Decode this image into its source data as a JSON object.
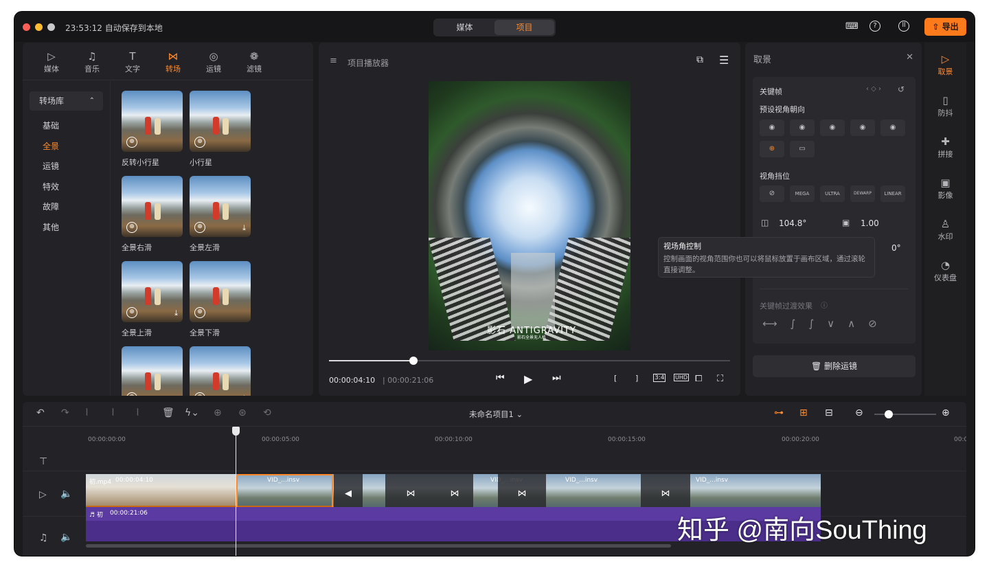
{
  "titlebar": {
    "autosave": "23:53:12 自动保存到本地",
    "tabs": [
      "媒体",
      "项目"
    ],
    "active_tab": "项目",
    "export_label": "导出",
    "traffic_colors": [
      "#ff5f57",
      "#febc2e",
      "#c9c9cc"
    ]
  },
  "left_tabs": [
    {
      "label": "媒体",
      "icon": "▷"
    },
    {
      "label": "音乐",
      "icon": "♫"
    },
    {
      "label": "文字",
      "icon": "T"
    },
    {
      "label": "转场",
      "icon": "⋈"
    },
    {
      "label": "运镜",
      "icon": "◎"
    },
    {
      "label": "滤镜",
      "icon": "❁"
    }
  ],
  "active_left_tab": "转场",
  "categories": {
    "header": "转场库",
    "items": [
      "基础",
      "全景",
      "运镜",
      "特效",
      "故障",
      "其他"
    ],
    "active": "全景"
  },
  "transitions": [
    {
      "label": "反转小行星",
      "download": false
    },
    {
      "label": "小行星",
      "download": false
    },
    {
      "label": "全景右滑",
      "download": false
    },
    {
      "label": "全景左滑",
      "download": true
    },
    {
      "label": "全景上滑",
      "download": true
    },
    {
      "label": "全景下滑",
      "download": false
    },
    {
      "label": "",
      "download": false
    },
    {
      "label": "",
      "download": true
    }
  ],
  "player": {
    "title": "项目播放器",
    "current_time": "00:00:04:10",
    "duration": "| 00:00:21:06",
    "progress": 0.21,
    "logo": "影石 ANTIGRAVITY",
    "logo_sub": "影石全景无人机",
    "ratio_label": "3:4",
    "uhd_label": "UHD"
  },
  "tooltip": {
    "title": "视场角控制",
    "body": "控制画面的视角范围你也可以将鼠标放置于画布区域，通过滚轮直接调整。"
  },
  "reframe": {
    "title": "取景",
    "keyframe": "关键帧",
    "preset_heading": "预设视角朝向",
    "view_preset_heading": "视角挡位",
    "lens_modes": [
      "MEGA",
      "ULTRA",
      "DEWARP",
      "LINEAR"
    ],
    "fov_value": "104.8°",
    "distance_value": "1.00",
    "partial_value": "0°",
    "transition_heading": "关键帧过渡效果",
    "delete_label": "删除运镜",
    "accent": "#ff8a2b"
  },
  "rail": [
    {
      "label": "取景",
      "icon": "▷"
    },
    {
      "label": "防抖",
      "icon": "▯"
    },
    {
      "label": "拼接",
      "icon": "✚"
    },
    {
      "label": "影像",
      "icon": "▣"
    },
    {
      "label": "水印",
      "icon": "♙"
    },
    {
      "label": "仪表盘",
      "icon": "◔"
    }
  ],
  "active_rail": "取景",
  "timeline": {
    "project_name": "未命名项目1 ⌄",
    "ruler": [
      "00:00:00:00",
      "00:00:05:00",
      "00:00:10:00",
      "00:00:15:00",
      "00:00:20:00",
      "00:0"
    ],
    "clip1_label": "初.mp4",
    "clip1_time": "00:00:04:10",
    "clip2_label": "VID_...insv",
    "clip3_label": "VID_...insv",
    "clip4_label": "VID_...insv",
    "clip5_label": "VID_...insv",
    "audio_label": "初",
    "audio_time": "00:00:21:06"
  },
  "watermark": "知乎 @南向SouThing"
}
